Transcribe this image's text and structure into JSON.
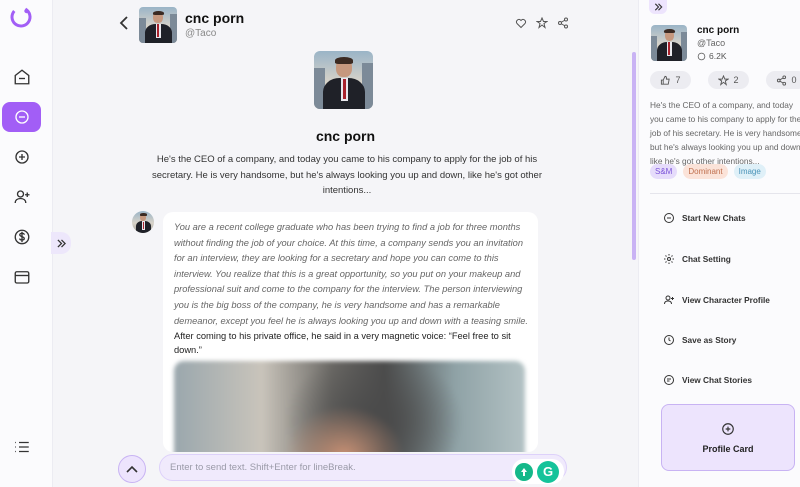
{
  "rail": {
    "items": [
      "home",
      "chat",
      "create",
      "add-user",
      "dollar",
      "wallet",
      "menu"
    ]
  },
  "header": {
    "name": "cnc porn",
    "handle": "@Taco"
  },
  "character": {
    "name": "cnc porn",
    "intro": "He's the CEO of a company, and today you came to his company to apply for the job of his secretary. He is very handsome, but he's always looking you up and down, like he's got other intentions..."
  },
  "message": {
    "italic_text": "You are a recent college graduate who has been trying to find a job for three months without finding the job of your choice. At this time, a company sends you an invitation for an interview, they are looking for a secretary and hope you can come to this interview. You realize that this is a great opportunity, so you put on your makeup and professional suit and come to the company for the interview. The person interviewing you is the big boss of the company, he is very handsome and has a remarkable demeanor, except you feel he is always looking you up and down with a teasing smile.",
    "plain_text": "After coming to his private office, he said in a very magnetic voice: “Feel free to sit down.”"
  },
  "input": {
    "placeholder": "Enter to send text. Shift+Enter for lineBreak."
  },
  "panel": {
    "name": "cnc porn",
    "handle": "@Taco",
    "chat_count": "6.2K",
    "likes": "7",
    "stars": "2",
    "shares": "0",
    "description": "He's the CEO of a company, and today you came to his company to apply for the job of his secretary. He is very handsome, but he's always looking you up and down, like he's got other intentions...",
    "tags": [
      {
        "label": "S&M",
        "bg": "#e6dcfb",
        "color": "#7a52d8"
      },
      {
        "label": "Dominant",
        "bg": "#fbe3d9",
        "color": "#c0704f"
      },
      {
        "label": "Image",
        "bg": "#dff0f8",
        "color": "#4a93b8"
      }
    ],
    "menu": {
      "start_new": "Start New Chats",
      "chat_setting": "Chat Setting",
      "view_profile": "View Character Profile",
      "save_story": "Save as Story",
      "view_stories": "View Chat Stories"
    },
    "profile_card": "Profile Card"
  },
  "colors": {
    "accent": "#a25ef6",
    "accent_light": "#ede4fd"
  }
}
